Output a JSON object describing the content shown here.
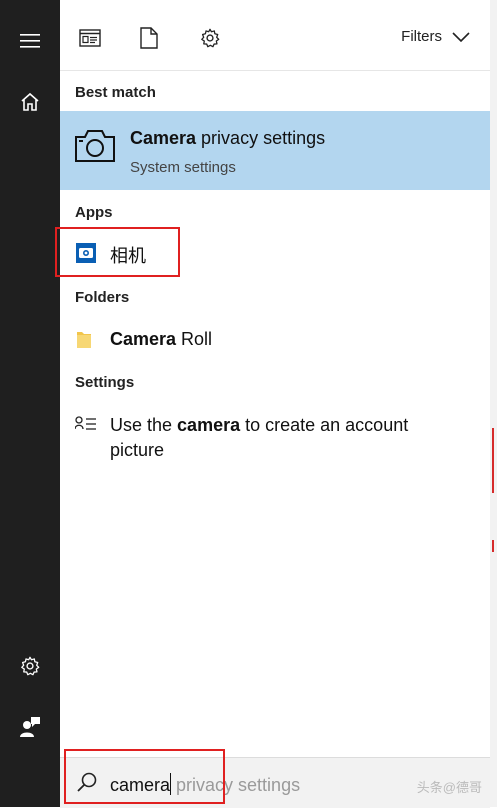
{
  "toolbar": {
    "filters_label": "Filters"
  },
  "sections": {
    "best_match": "Best match",
    "apps": "Apps",
    "folders": "Folders",
    "settings": "Settings"
  },
  "best_match": {
    "title_bold": "Camera",
    "title_rest": " privacy settings",
    "subtitle": "System settings"
  },
  "apps": {
    "camera_app_label": "相机"
  },
  "folders": {
    "item_bold": "Camera",
    "item_rest": " Roll"
  },
  "settings": {
    "line1_prefix": "Use the ",
    "line1_bold": "camera",
    "line1_suffix": " to create an account",
    "line2": "picture"
  },
  "search": {
    "typed": "camera",
    "suggestion": " privacy settings"
  },
  "watermark": "头条@德哥",
  "colors": {
    "rail": "#1f1f1f",
    "selected_bg": "#b3d6ef",
    "highlight_box": "#e02020",
    "camera_app_tile": "#0a5fb4"
  }
}
